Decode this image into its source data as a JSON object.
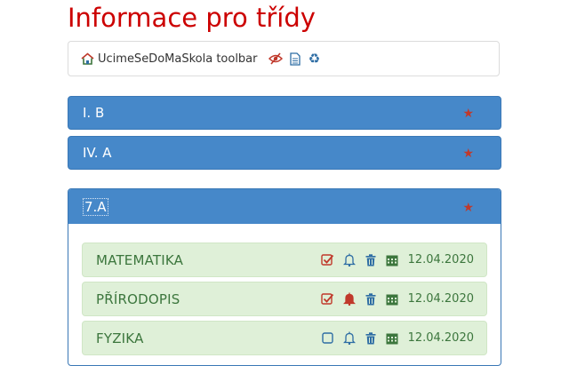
{
  "page": {
    "title": "Informace pro třídy"
  },
  "toolbar": {
    "brand": "UcimeSeDoMaSkola toolbar",
    "icons": [
      "home-icon",
      "eye-slash-icon",
      "document-icon",
      "recycle-icon"
    ]
  },
  "classes": [
    {
      "label": "I. B",
      "expanded": false
    },
    {
      "label": "IV. A",
      "expanded": false
    },
    {
      "label": "7.A",
      "expanded": true,
      "subjects": [
        {
          "name": "MATEMATIKA",
          "checked": true,
          "bell_filled": false,
          "date": "12.04.2020"
        },
        {
          "name": "PŘÍRODOPIS",
          "checked": true,
          "bell_filled": true,
          "date": "12.04.2020"
        },
        {
          "name": "FYZIKA",
          "checked": false,
          "bell_filled": false,
          "date": "12.04.2020"
        }
      ]
    }
  ],
  "colors": {
    "title": "#cc0000",
    "panel_header": "#4688c9",
    "star": "#c0392b",
    "subject_bg": "#dff0d8",
    "subject_text": "#3c763d",
    "icon_red": "#c0392b",
    "icon_blue": "#2e6da4"
  }
}
